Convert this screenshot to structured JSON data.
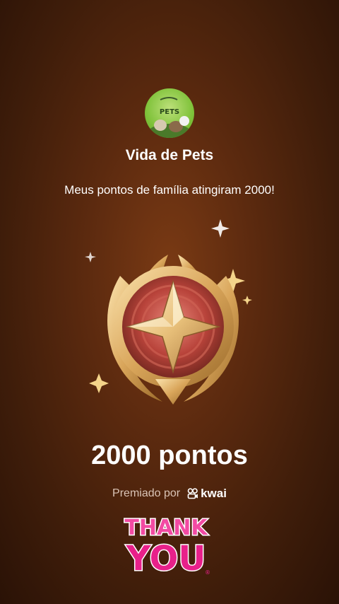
{
  "account": {
    "name": "Vida de Pets",
    "avatar_logo_text": "PETS"
  },
  "message": "Meus pontos de família atingiram 2000!",
  "points_label": "2000 pontos",
  "awarded_by": "Premiado por",
  "brand": "kwai",
  "sticker": {
    "line1": "THANK",
    "line2": "YOU"
  },
  "colors": {
    "background_center": "#7a3a14",
    "background_edge": "#2a1206",
    "badge_gold": "#e8c07a",
    "badge_red": "#b8433a",
    "sticker_pink": "#e8208a"
  }
}
